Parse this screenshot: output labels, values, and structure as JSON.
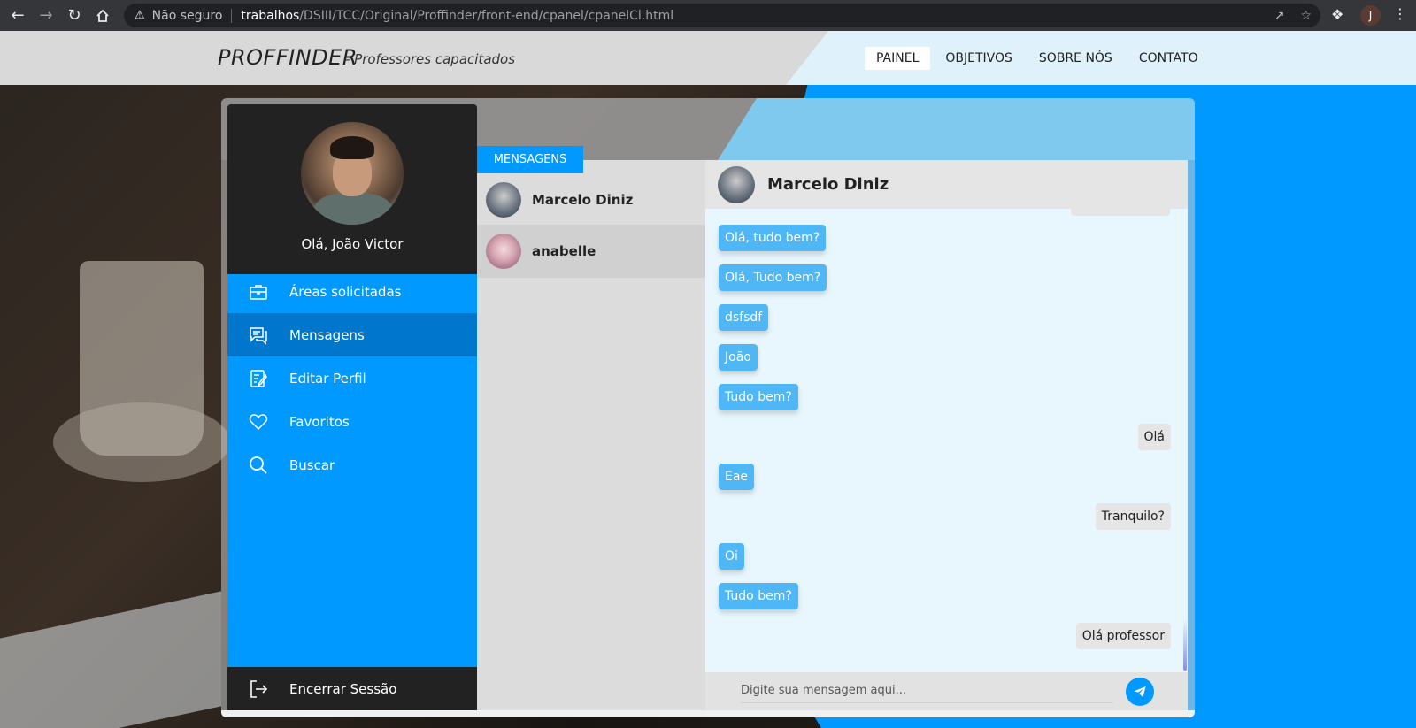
{
  "browser": {
    "security_label": "Não seguro",
    "url_host": "trabalhos",
    "url_path": "/DSIII/TCC/Original/Proffinder/front-end/cpanel/cpanelCl.html",
    "profile_initial": "J"
  },
  "site": {
    "logo": "PROFFINDER",
    "tagline": "- Professores capacitados",
    "nav": [
      {
        "label": "PAINEL",
        "active": true
      },
      {
        "label": "OBJETIVOS"
      },
      {
        "label": "SOBRE NÓS"
      },
      {
        "label": "CONTATO"
      }
    ]
  },
  "sidebar": {
    "greeting": "Olá, João Victor",
    "items": [
      {
        "label": "Áreas solicitadas",
        "icon": "briefcase-icon"
      },
      {
        "label": "Mensagens",
        "icon": "chat-icon",
        "active": true
      },
      {
        "label": "Editar Perfil",
        "icon": "edit-profile-icon"
      },
      {
        "label": "Favoritos",
        "icon": "heart-icon"
      },
      {
        "label": "Buscar",
        "icon": "search-icon"
      }
    ],
    "logout": "Encerrar Sessão"
  },
  "conversations": {
    "tab_label": "MENSAGENS",
    "items": [
      {
        "name": "Marcelo Diniz"
      },
      {
        "name": "anabelle"
      }
    ]
  },
  "chat": {
    "contact_name": "Marcelo Diniz",
    "messages": [
      {
        "text": "Olá, tudo bem?",
        "from": "received"
      },
      {
        "text": "Olá, Tudo bem?",
        "from": "received"
      },
      {
        "text": "dsfsdf",
        "from": "received"
      },
      {
        "text": "João",
        "from": "received"
      },
      {
        "text": "Tudo bem?",
        "from": "received"
      },
      {
        "text": "Olá",
        "from": "sent"
      },
      {
        "text": "Eae",
        "from": "received"
      },
      {
        "text": "Tranquilo?",
        "from": "sent"
      },
      {
        "text": "Oi",
        "from": "received"
      },
      {
        "text": "Tudo bem?",
        "from": "received"
      },
      {
        "text": "Olá professor",
        "from": "sent"
      }
    ],
    "input_placeholder": "Digite sua mensagem aqui..."
  },
  "colors": {
    "primary": "#0099ff",
    "active_menu": "#0077cc",
    "received_bubble": "#4fb7f5",
    "sent_bubble": "#e5e5e5"
  }
}
